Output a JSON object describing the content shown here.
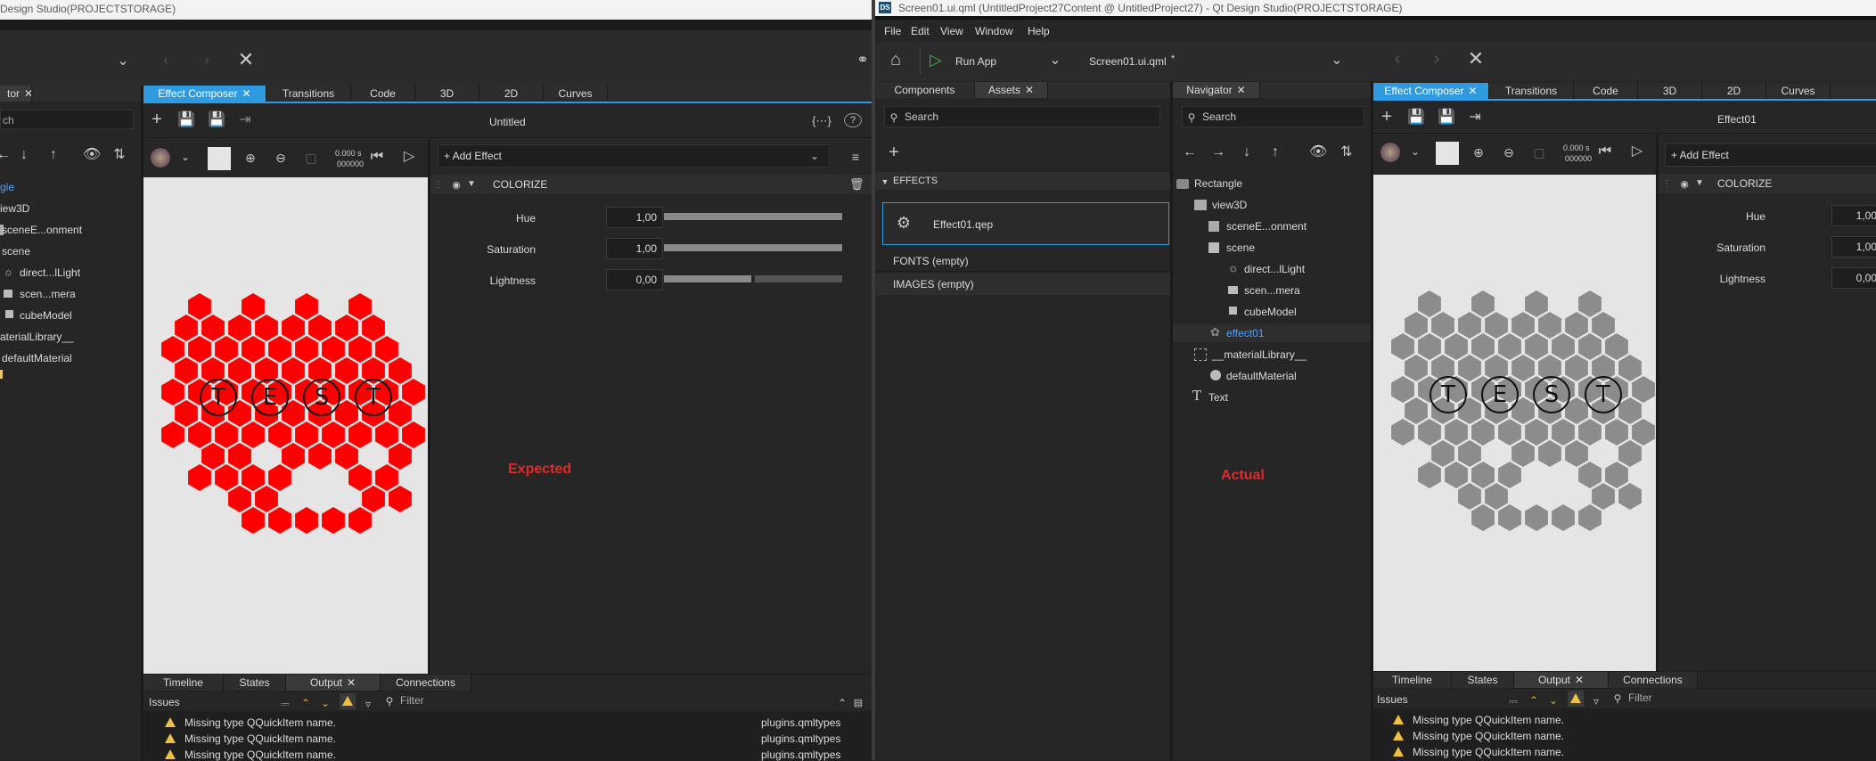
{
  "left_window": {
    "title": "Design Studio(PROJECTSTORAGE)",
    "tree_tab_partial": "tor",
    "search_partial": "ch",
    "tree": [
      {
        "label": "gle",
        "selected": true
      },
      {
        "label": "iew3D"
      },
      {
        "label": "sceneE...onment"
      },
      {
        "label": "scene"
      },
      {
        "label": "direct...lLight"
      },
      {
        "label": "scen...mera"
      },
      {
        "label": "cubeModel"
      },
      {
        "label": "aterialLibrary__"
      },
      {
        "label": "defaultMaterial"
      }
    ],
    "tabs": [
      "Effect Composer",
      "Transitions",
      "Code",
      "3D",
      "2D",
      "Curves"
    ],
    "effect_title": "Untitled",
    "time_display": "0.000 s",
    "frame_display": "000000",
    "add_effect": "+ Add Effect",
    "section": "COLORIZE",
    "properties": [
      {
        "label": "Hue",
        "value": "1,00",
        "fill": 1.0
      },
      {
        "label": "Saturation",
        "value": "1,00",
        "fill": 1.0
      },
      {
        "label": "Lightness",
        "value": "0,00",
        "fill": 0.5
      }
    ],
    "annotation": "Expected",
    "bottom_tabs": [
      "Timeline",
      "States",
      "Output",
      "Connections"
    ],
    "issues_title": "Issues",
    "filter_placeholder": "Filter",
    "issues": [
      {
        "text": "Missing type QQuickItem name.",
        "source": "plugins.qmltypes"
      },
      {
        "text": "Missing type QQuickItem name.",
        "source": "plugins.qmltypes"
      },
      {
        "text": "Missing type QQuickItem name.",
        "source": "plugins.qmltypes"
      }
    ]
  },
  "right_window": {
    "title": "Screen01.ui.qml (UntitledProject27Content @ UntitledProject27) - Qt Design Studio(PROJECTSTORAGE)",
    "menu": [
      "File",
      "Edit",
      "View",
      "Window",
      "Help"
    ],
    "run_app": "Run App",
    "file_dropdown": "Screen01.ui.qml",
    "modified_marker": "*",
    "asset_tabs": [
      "Components",
      "Assets"
    ],
    "search_placeholder": "Search",
    "effects_header": "EFFECTS",
    "effect_item": "Effect01.qep",
    "fonts_header": "FONTS (empty)",
    "images_header": "IMAGES (empty)",
    "navigator_tab": "Navigator",
    "nav_search": "Search",
    "nav_tree": [
      {
        "label": "Rectangle"
      },
      {
        "label": "view3D"
      },
      {
        "label": "sceneE...onment"
      },
      {
        "label": "scene"
      },
      {
        "label": "direct...lLight"
      },
      {
        "label": "scen...mera"
      },
      {
        "label": "cubeModel"
      },
      {
        "label": "effect01",
        "selected": true
      },
      {
        "label": "__materialLibrary__"
      },
      {
        "label": "defaultMaterial"
      },
      {
        "label": "Text"
      }
    ],
    "tabs": [
      "Effect Composer",
      "Transitions",
      "Code",
      "3D",
      "2D",
      "Curves"
    ],
    "effect_title": "Effect01",
    "time_display": "0.000 s",
    "frame_display": "000000",
    "add_effect": "+ Add Effect",
    "section": "COLORIZE",
    "properties": [
      {
        "label": "Hue",
        "value": "1,00"
      },
      {
        "label": "Saturation",
        "value": "1,00"
      },
      {
        "label": "Lightness",
        "value": "0,00"
      }
    ],
    "annotation": "Actual",
    "bottom_tabs": [
      "Timeline",
      "States",
      "Output",
      "Connections"
    ],
    "issues_title": "Issues",
    "filter_placeholder": "Filter",
    "issues": [
      {
        "text": "Missing type QQuickItem name."
      },
      {
        "text": "Missing type QQuickItem name."
      },
      {
        "text": "Missing type QQuickItem name."
      }
    ]
  },
  "canvas_text": [
    "T",
    "E",
    "S",
    "T"
  ],
  "colors": {
    "accent": "#2f9ae0",
    "expected_hex": "#ff0000",
    "actual_hex": "#8c8c8c",
    "annotation": "#e02a2a",
    "warning": "#f0c040"
  }
}
